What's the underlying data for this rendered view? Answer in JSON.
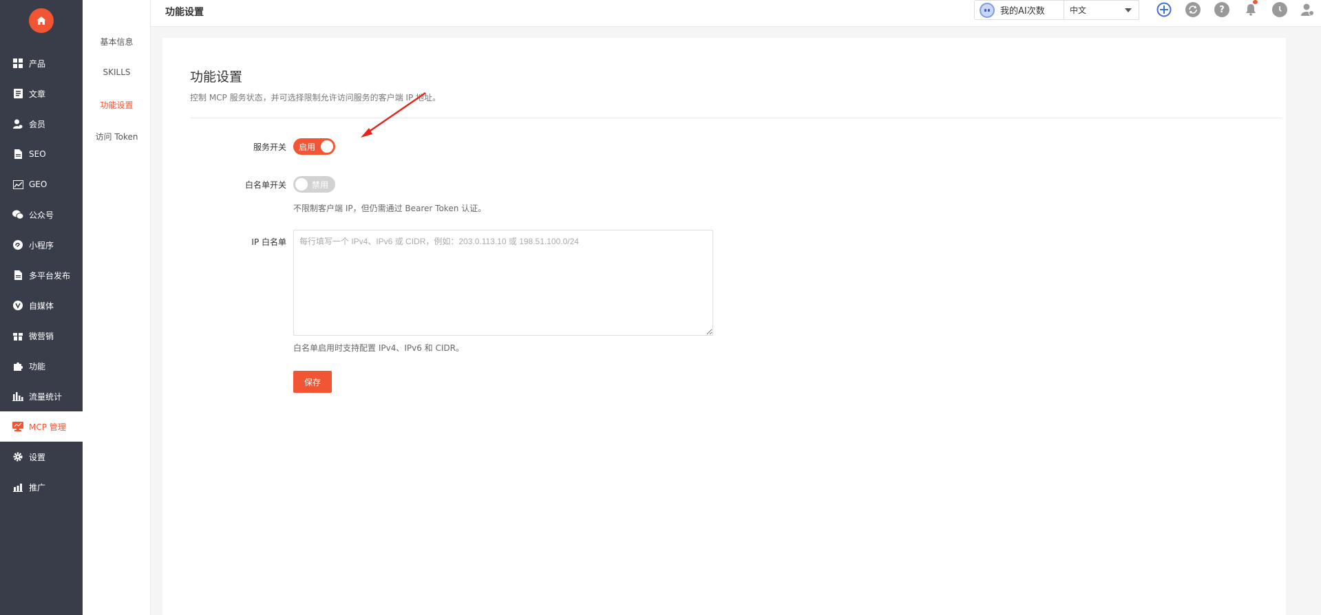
{
  "sidebar": {
    "items": [
      {
        "label": "产品",
        "icon": "grid-icon"
      },
      {
        "label": "文章",
        "icon": "article-icon"
      },
      {
        "label": "会员",
        "icon": "user-icon"
      },
      {
        "label": "SEO",
        "icon": "document-icon"
      },
      {
        "label": "GEO",
        "icon": "chart-icon"
      },
      {
        "label": "公众号",
        "icon": "wechat-icon"
      },
      {
        "label": "小程序",
        "icon": "miniprogram-icon"
      },
      {
        "label": "多平台发布",
        "icon": "document-icon"
      },
      {
        "label": "自媒体",
        "icon": "vlog-icon"
      },
      {
        "label": "微营销",
        "icon": "gift-icon"
      },
      {
        "label": "功能",
        "icon": "puzzle-icon"
      },
      {
        "label": "流量统计",
        "icon": "bar-chart-icon"
      },
      {
        "label": "MCP 管理",
        "icon": "monitor-icon",
        "active": true
      },
      {
        "label": "设置",
        "icon": "gear-icon"
      },
      {
        "label": "推广",
        "icon": "promote-icon"
      }
    ]
  },
  "submenu": {
    "items": [
      {
        "label": "基本信息"
      },
      {
        "label": "SKILLS"
      },
      {
        "label": "功能设置",
        "active": true
      },
      {
        "label": "访问 Token"
      }
    ]
  },
  "topbar": {
    "title": "功能设置",
    "ai_button": "我的AI次数",
    "language": "中文"
  },
  "main": {
    "title": "功能设置",
    "description": "控制 MCP 服务状态，并可选择限制允许访问服务的客户端 IP 地址。",
    "service_switch": {
      "label": "服务开关",
      "state_text": "启用",
      "on": true
    },
    "whitelist_switch": {
      "label": "白名单开关",
      "state_text": "禁用",
      "on": false,
      "hint": "不限制客户端 IP，但仍需通过 Bearer Token 认证。"
    },
    "ip_whitelist": {
      "label": "IP 白名单",
      "value": "",
      "placeholder": "每行填写一个 IPv4、IPv6 或 CIDR，例如：203.0.113.10 或 198.51.100.0/24",
      "hint": "白名单启用时支持配置 IPv4、IPv6 和 CIDR。"
    },
    "save_label": "保存"
  },
  "colors": {
    "accent": "#f15533",
    "sidebar_bg": "#393d49",
    "toggle_off": "#d2d2d2"
  }
}
